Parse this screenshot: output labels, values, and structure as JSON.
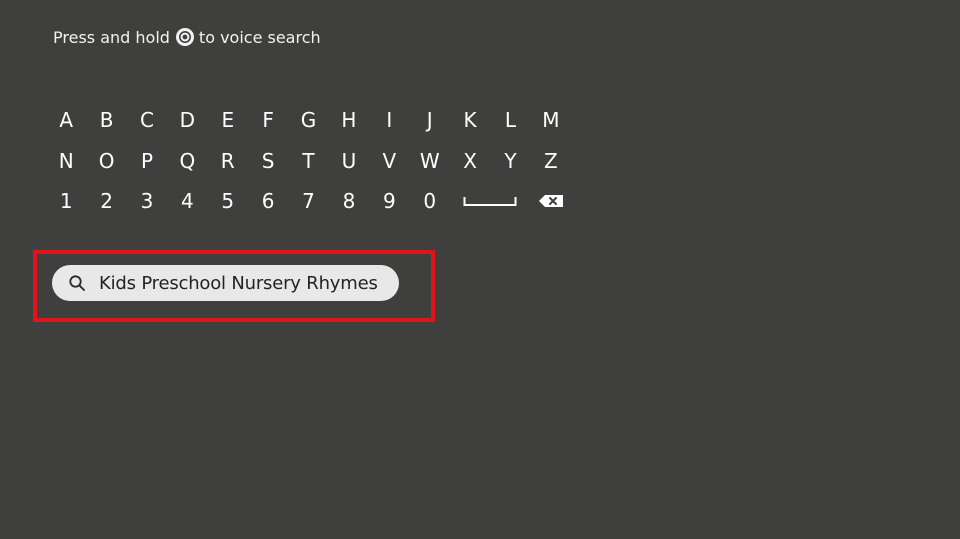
{
  "voice_hint": {
    "prefix": "Press and hold",
    "suffix": "to voice search"
  },
  "keyboard": {
    "rows": [
      [
        "A",
        "B",
        "C",
        "D",
        "E",
        "F",
        "G",
        "H",
        "I",
        "J",
        "K",
        "L",
        "M"
      ],
      [
        "N",
        "O",
        "P",
        "Q",
        "R",
        "S",
        "T",
        "U",
        "V",
        "W",
        "X",
        "Y",
        "Z"
      ],
      [
        "1",
        "2",
        "3",
        "4",
        "5",
        "6",
        "7",
        "8",
        "9",
        "0"
      ]
    ]
  },
  "suggestion": {
    "text": "Kids Preschool Nursery Rhymes"
  },
  "colors": {
    "background": "#3f3f3d",
    "highlight": "#e1141e",
    "pill": "#e8e8e8"
  },
  "icons": {
    "mic": "microphone-button-icon",
    "space": "space-bar-icon",
    "backspace": "backspace-icon",
    "search": "search-icon"
  }
}
